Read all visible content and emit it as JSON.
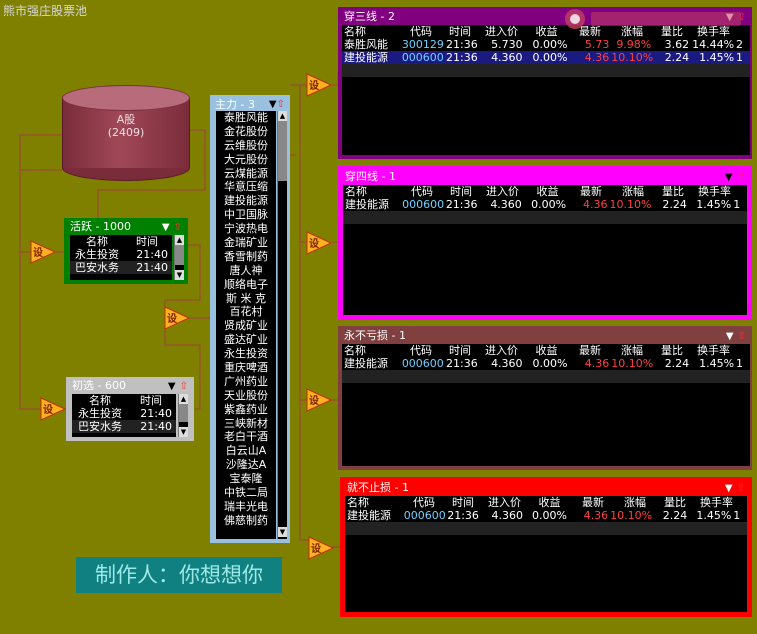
{
  "title": "熊市强庄股票池",
  "source": {
    "name": "A股",
    "count": "(2409)"
  },
  "triangle_label": "设",
  "zhuli": {
    "header": "主力 - 3",
    "stocks": [
      "泰胜风能",
      "金花股份",
      "云维股份",
      "大元股份",
      "云煤能源",
      "华意压缩",
      "建投能源",
      "中卫国脉",
      "宁波热电",
      "金瑞矿业",
      "香雪制药",
      "唐人神",
      "顺络电子",
      "斯 米 克",
      "百花村",
      "贤成矿业",
      "盛达矿业",
      "永生投资",
      "重庆啤酒",
      "广州药业",
      "天业股份",
      "紫鑫药业",
      "三峡新材",
      "老白干酒",
      "白云山A",
      "沙隆达A",
      "宝泰隆",
      "中铁二局",
      "瑞丰光电",
      "佛慈制药"
    ]
  },
  "huoyue": {
    "header": "活跃 - 1000",
    "columns": {
      "name": "名称",
      "time": "时间"
    },
    "rows": [
      {
        "name": "永生投资",
        "time": "21:40"
      },
      {
        "name": "巴安水务",
        "time": "21:40"
      }
    ]
  },
  "chuxuan": {
    "header": "初选 - 600",
    "columns": {
      "name": "名称",
      "time": "时间"
    },
    "rows": [
      {
        "name": "永生投资",
        "time": "21:40"
      },
      {
        "name": "巴安水务",
        "time": "21:40"
      }
    ]
  },
  "columns": {
    "name": "名称",
    "code": "代码",
    "time": "时间",
    "price": "进入价",
    "gain": "收益",
    "last": "最新",
    "chg": "涨幅",
    "vol": "量比",
    "turn": "换手率"
  },
  "panels": [
    {
      "header": "穿三线 - 2",
      "rows": [
        {
          "name": "泰胜风能",
          "code": "300129",
          "time": "21:36",
          "price": "5.730",
          "gain": "0.00%",
          "last": "5.73",
          "chg": "9.98%",
          "vol": "3.62",
          "turn": "14.44%",
          "extra": "2"
        },
        {
          "name": "建投能源",
          "code": "000600",
          "time": "21:36",
          "price": "4.360",
          "gain": "0.00%",
          "last": "4.36",
          "chg": "10.10%",
          "vol": "2.24",
          "turn": "1.45%",
          "extra": "1"
        }
      ]
    },
    {
      "header": "穿四线 - 1",
      "rows": [
        {
          "name": "建投能源",
          "code": "000600",
          "time": "21:36",
          "price": "4.360",
          "gain": "0.00%",
          "last": "4.36",
          "chg": "10.10%",
          "vol": "2.24",
          "turn": "1.45%",
          "extra": "1"
        }
      ]
    },
    {
      "header": "永不亏损 - 1",
      "rows": [
        {
          "name": "建投能源",
          "code": "000600",
          "time": "21:36",
          "price": "4.360",
          "gain": "0.00%",
          "last": "4.36",
          "chg": "10.10%",
          "vol": "2.24",
          "turn": "1.45%",
          "extra": "1"
        }
      ]
    },
    {
      "header": "就不止损 - 1",
      "rows": [
        {
          "name": "建投能源",
          "code": "000600",
          "time": "21:36",
          "price": "4.360",
          "gain": "0.00%",
          "last": "4.36",
          "chg": "10.10%",
          "vol": "2.24",
          "turn": "1.45%",
          "extra": "1"
        }
      ]
    }
  ],
  "maker": "制作人：你想想你",
  "colors": {
    "background": "#808000",
    "panel1": "#800080",
    "panel2": "#ff00ff",
    "panel3": "#804040",
    "panel4": "#ff0000",
    "huoyue": "#008000",
    "chuxuan": "#c0c0c0",
    "zhuli": "#9ac0e0",
    "maker_bg": "#108080"
  }
}
